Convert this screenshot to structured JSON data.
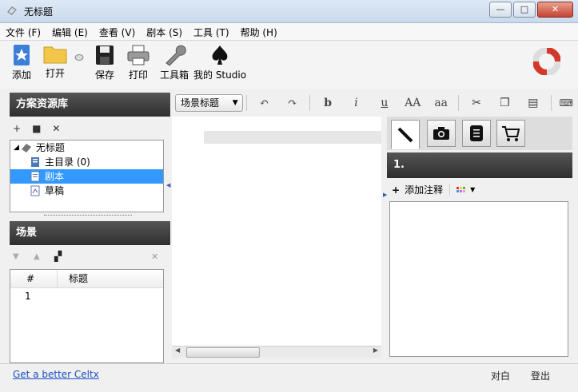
{
  "window": {
    "title": "无标题",
    "controls": {
      "minimize": "—",
      "maximize": "□",
      "close": "✕"
    }
  },
  "menu": [
    "文件 (F)",
    "编辑 (E)",
    "查看 (V)",
    "剧本 (S)",
    "工具 (T)",
    "帮助 (H)"
  ],
  "toolbar": {
    "add": "添加",
    "open": "打开",
    "save": "保存",
    "print": "打印",
    "tools": "工具箱",
    "studio": "我的 Studio"
  },
  "project_library": {
    "title": "方案资源库",
    "tools": [
      "+",
      "■",
      "✕"
    ],
    "tree": [
      {
        "label": "无标题",
        "icon": "project-icon",
        "level": 0
      },
      {
        "label": "主目录 (0)",
        "icon": "catalog-icon",
        "level": 1
      },
      {
        "label": "剧本",
        "icon": "script-icon",
        "level": 1,
        "selected": true
      },
      {
        "label": "草稿",
        "icon": "sketch-icon",
        "level": 1
      }
    ]
  },
  "scenes": {
    "title": "场景",
    "columns": [
      "#",
      "标题"
    ],
    "rows": [
      {
        "num": "1",
        "title": ""
      }
    ]
  },
  "format_toolbar": {
    "element_type": "场景标题",
    "buttons": [
      "b",
      "i",
      "u",
      "AA",
      "aa"
    ]
  },
  "right_panel": {
    "heading": "1.",
    "add_note": "添加注释"
  },
  "status": {
    "link": "Get a better Celtx",
    "dialogue": "对白",
    "logout": "登出"
  },
  "colors": {
    "selected": "#3399ff",
    "panel_header": "#3a3a3a",
    "link": "#1a4fc4"
  }
}
